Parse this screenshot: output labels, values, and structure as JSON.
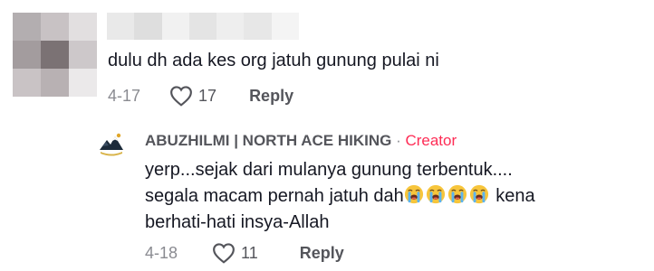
{
  "comment": {
    "text": "dulu dh ada kes org jatuh gunung pulai ni",
    "date": "4-17",
    "likes": "17",
    "reply_label": "Reply",
    "avatar_pixel_colors": [
      "#b3aeb0",
      "#c8c2c4",
      "#e2dfe0",
      "#a39c9e",
      "#7b7274",
      "#cdc8ca",
      "#c9c3c5",
      "#b8b1b3",
      "#ebe9ea"
    ],
    "name_blur_colors": [
      "#e9e9e9",
      "#dedede",
      "#f1f1f1",
      "#e4e4e4",
      "#eeeeee",
      "#e7e7e7",
      "#f4f4f4"
    ]
  },
  "reply": {
    "author": "ABUZHILMI | NORTH ACE HIKING",
    "separator": " · ",
    "badge": "Creator",
    "text_line1": "yerp...sejak dari mulanya gunung terbentuk....",
    "text_line2_before": "segala macam pernah jatuh dah",
    "text_line2_after": " kena",
    "text_line3": "berhati-hati insya-Allah",
    "emoji_count": 4,
    "emoji_name": "loudly-crying-face",
    "date": "4-18",
    "likes": "11",
    "reply_label": "Reply"
  },
  "colors": {
    "creator_accent": "#fe2c55",
    "text_primary": "#161823",
    "text_secondary": "#8a8b91"
  }
}
